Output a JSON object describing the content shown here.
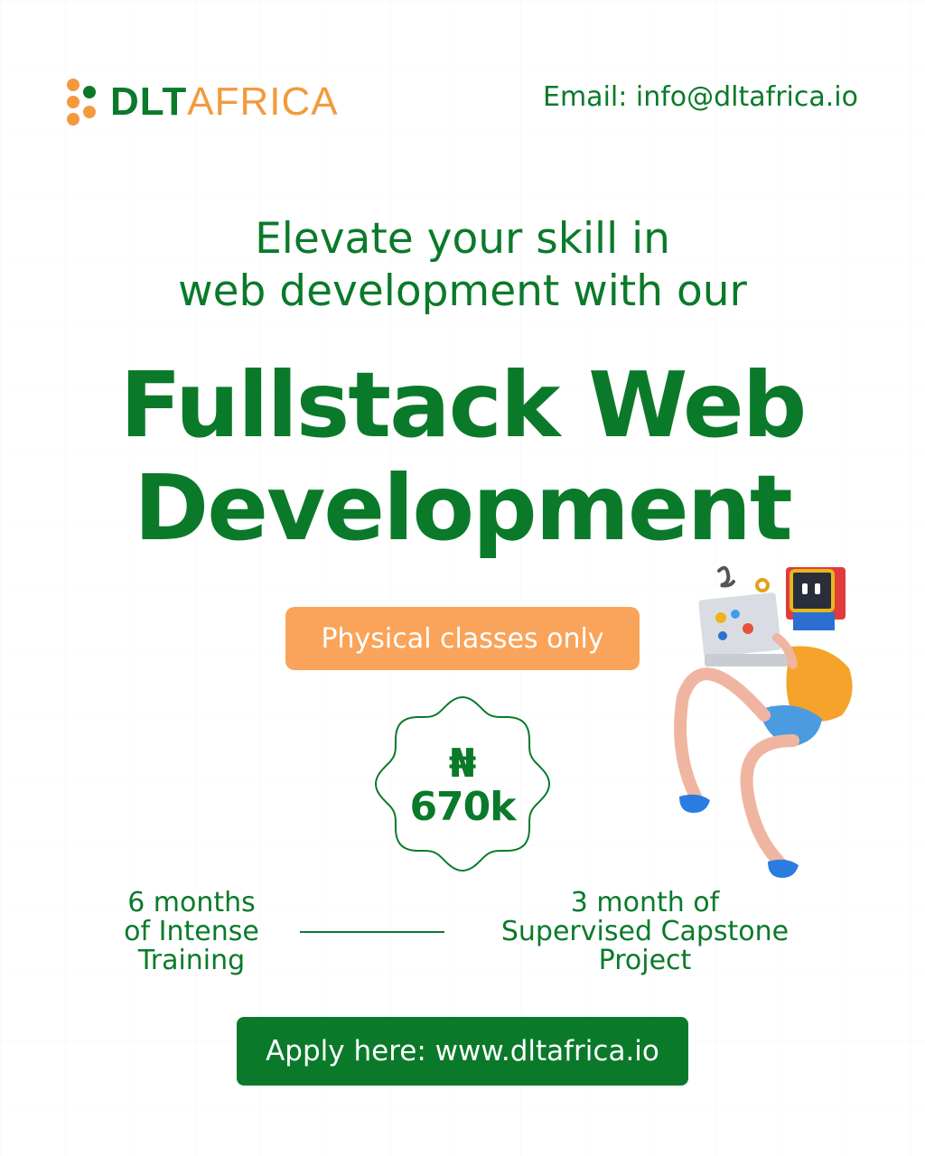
{
  "brand": {
    "name_part1": "DLT",
    "name_part2": "AFRICA"
  },
  "header": {
    "email": "Email: info@dltafrica.io"
  },
  "hero": {
    "subtitle_line1": "Elevate your skill in",
    "subtitle_line2": "web development with our",
    "headline_line1": "Fullstack Web",
    "headline_line2": "Development"
  },
  "pill_label": "Physical classes only",
  "price": {
    "symbol": "₦",
    "amount": "670k"
  },
  "features": {
    "left": [
      "6 months",
      "of Intense",
      "Training"
    ],
    "right": [
      "3 month of",
      "Supervised Capstone",
      "Project"
    ]
  },
  "cta_label": "Apply here: www.dltafrica.io",
  "colors": {
    "green": "#0a7a2a",
    "orange": "#f9a45a",
    "logo_orange": "#f39a3d"
  },
  "icons": {
    "logo": "dltafrica-logo-icon",
    "illustration": "person-with-laptop-illustration"
  }
}
